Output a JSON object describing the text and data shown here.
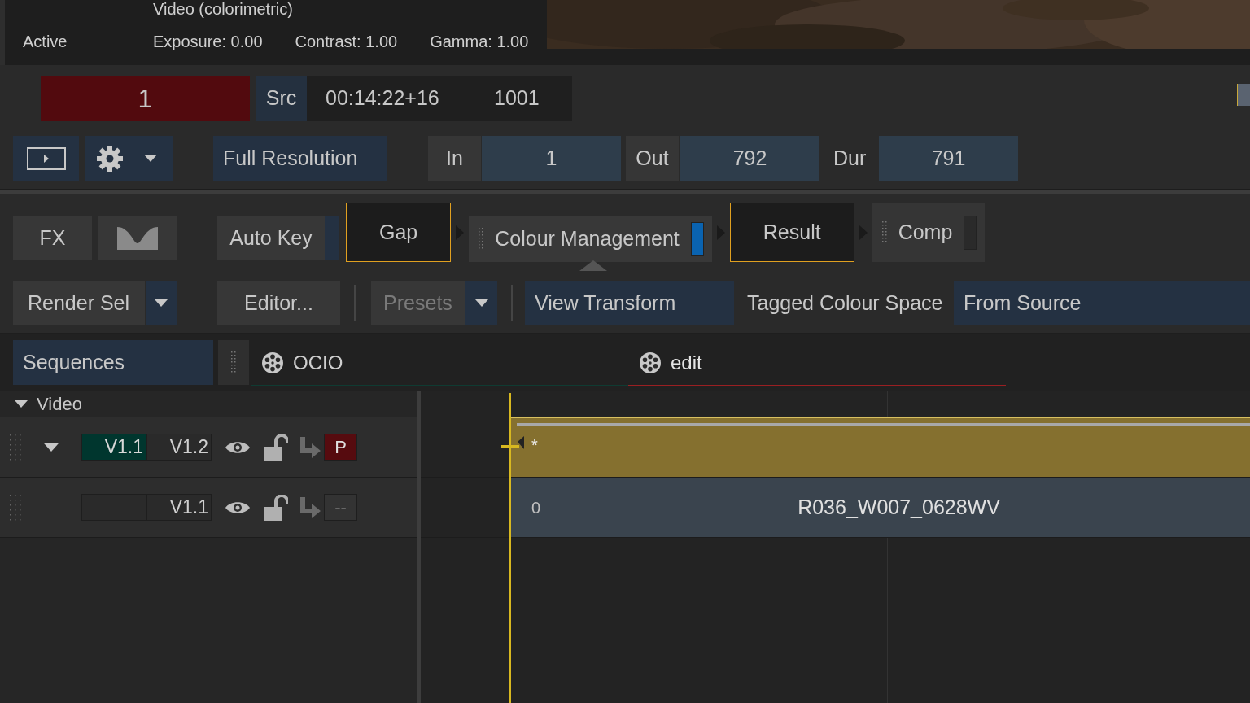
{
  "viewer_info": {
    "status": "Active",
    "title": "Video (colorimetric)",
    "readouts": [
      "Exposure: 0.00",
      "Contrast: 1.00",
      "Gamma: 1.00"
    ]
  },
  "timecode_bar": {
    "frame": "1",
    "source_label": "Src",
    "timecode": "00:14:22+16",
    "frame_number": "1001"
  },
  "playback_bar": {
    "resolution": "Full Resolution",
    "in_label": "In",
    "in_value": "1",
    "out_label": "Out",
    "out_value": "792",
    "duration_label": "Dur",
    "duration_value": "791"
  },
  "node_graph": {
    "fx": "FX",
    "auto_key": "Auto Key",
    "nodes": [
      {
        "kind": "terminal",
        "label": "Gap",
        "selected": true
      },
      {
        "kind": "effect",
        "label": "Colour Management",
        "selected": true,
        "on": true
      },
      {
        "kind": "terminal",
        "label": "Result",
        "selected": true
      },
      {
        "kind": "effect",
        "label": "Comp",
        "selected": false,
        "on": false
      }
    ]
  },
  "controls": {
    "render": "Render Sel",
    "editor": "Editor...",
    "presets": {
      "label": "Presets",
      "disabled": true
    },
    "view_transform": "View Transform",
    "tagged_label": "Tagged Colour Space",
    "tagged_value": "From Source"
  },
  "sequences_button": "Sequences",
  "tabs": [
    {
      "label": "OCIO",
      "selected": false,
      "color": "#0f3b32"
    },
    {
      "label": "edit",
      "selected": true,
      "color": "#9a1f22"
    }
  ],
  "timeline": {
    "group": "Video",
    "expanded": true,
    "tracks": [
      {
        "kind": "stack",
        "expanded": true,
        "version": "V1.1",
        "alt_version": "V1.2",
        "visible": true,
        "locked": false,
        "badge": "P",
        "primary": true,
        "clip": {
          "kind": "gap",
          "label": "*"
        }
      },
      {
        "kind": "single",
        "version": "V1.1",
        "visible": true,
        "locked": false,
        "badge": "--",
        "primary": false,
        "clip": {
          "kind": "media",
          "start": "0",
          "name": "R036_W007_0628WV"
        }
      }
    ]
  }
}
